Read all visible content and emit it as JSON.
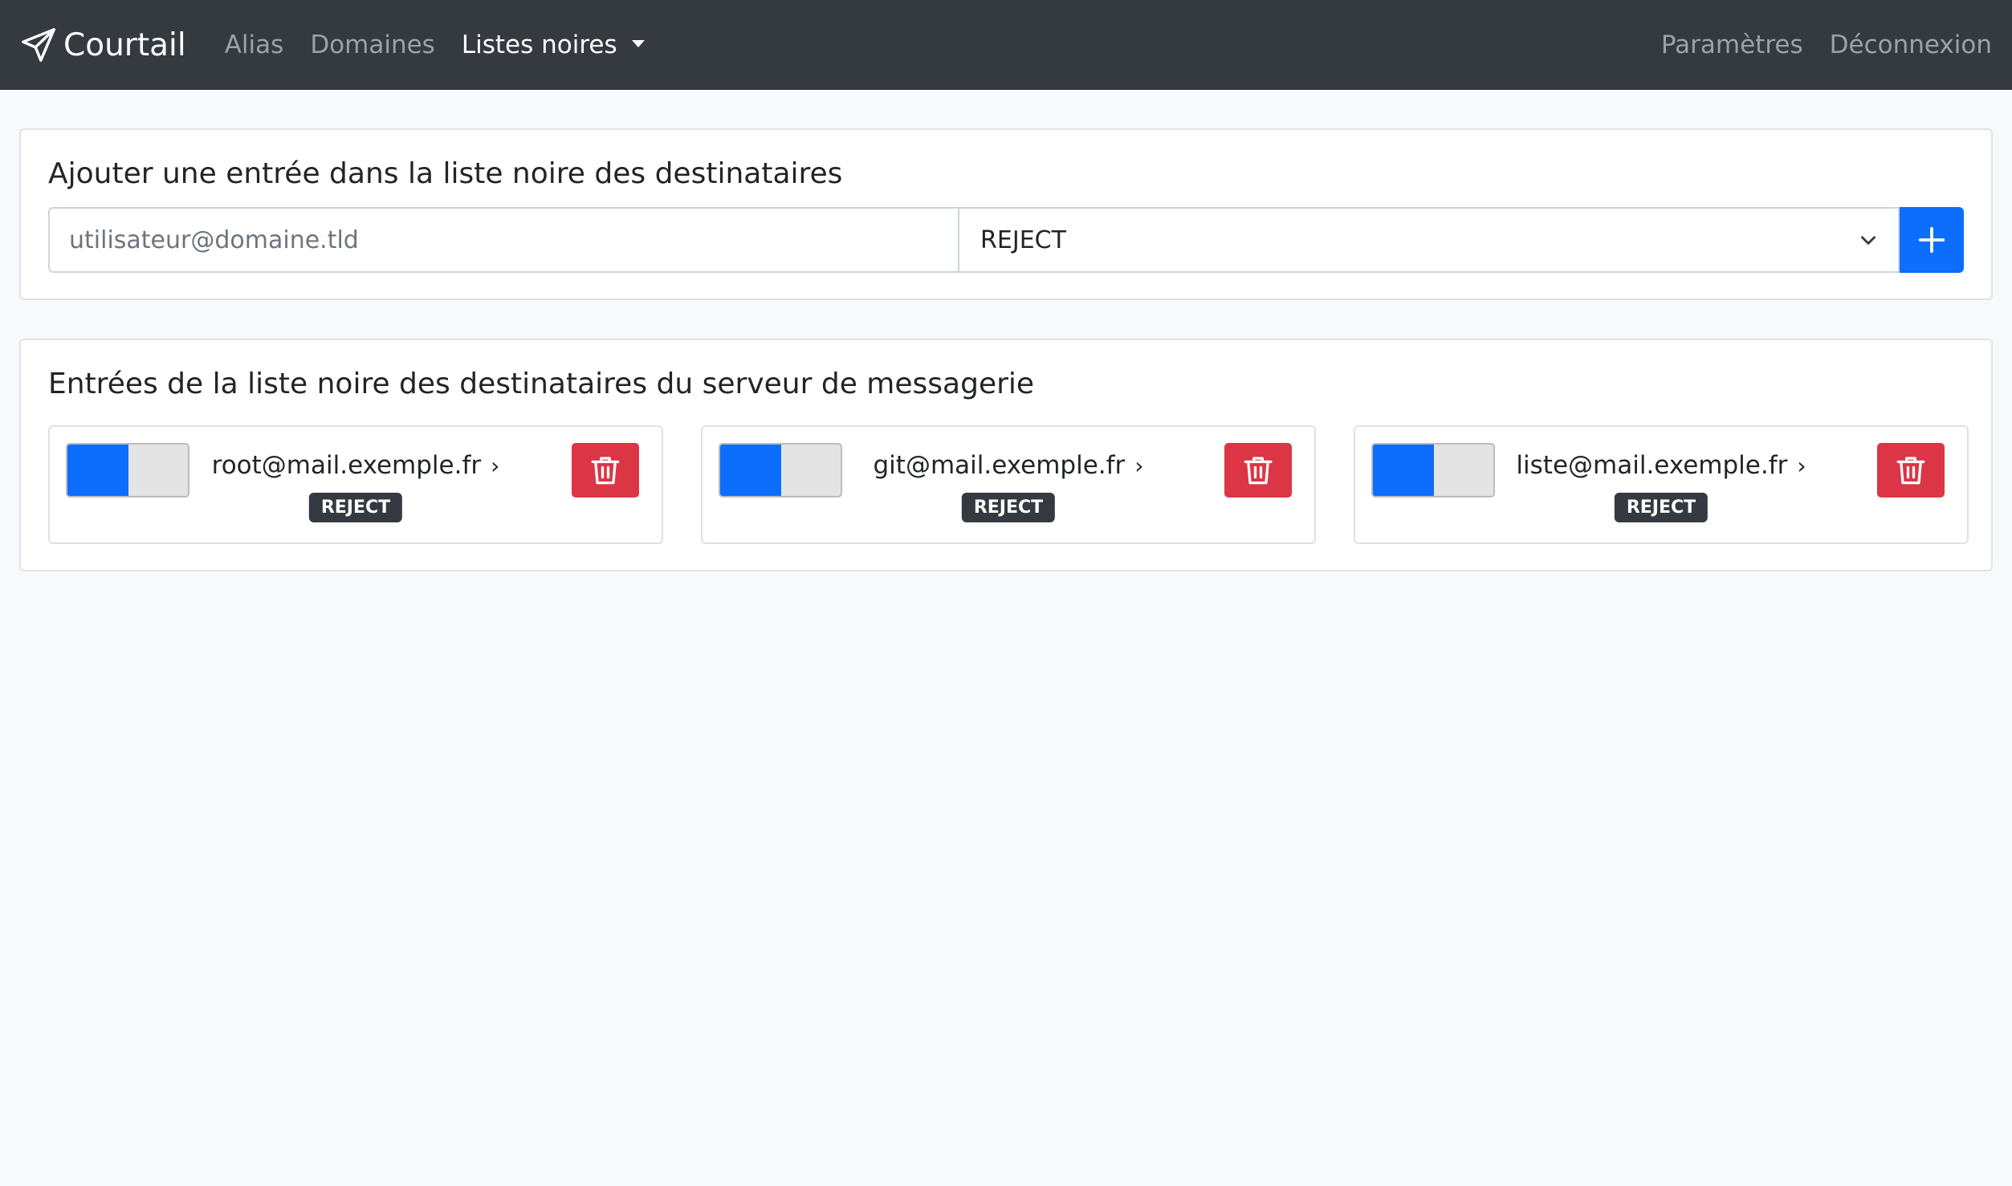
{
  "navbar": {
    "brand": "Courtail",
    "links": [
      "Alias",
      "Domaines"
    ],
    "active_dropdown": "Listes noires",
    "right_links": [
      "Paramètres",
      "Déconnexion"
    ]
  },
  "add_card": {
    "title": "Ajouter une entrée dans la liste noire des destinataires",
    "email_placeholder": "utilisateur@domaine.tld",
    "action_selected": "REJECT"
  },
  "list_card": {
    "title": "Entrées de la liste noire des destinataires du serveur de messagerie",
    "entries": [
      {
        "address": "root@mail.exemple.fr",
        "action": "REJECT",
        "enabled": true
      },
      {
        "address": "git@mail.exemple.fr",
        "action": "REJECT",
        "enabled": true
      },
      {
        "address": "liste@mail.exemple.fr",
        "action": "REJECT",
        "enabled": true
      }
    ]
  },
  "colors": {
    "navbar": "#343a40",
    "primary": "#0d6efd",
    "danger": "#dc3545",
    "badge": "#343a40",
    "background": "#f8f9fa"
  }
}
